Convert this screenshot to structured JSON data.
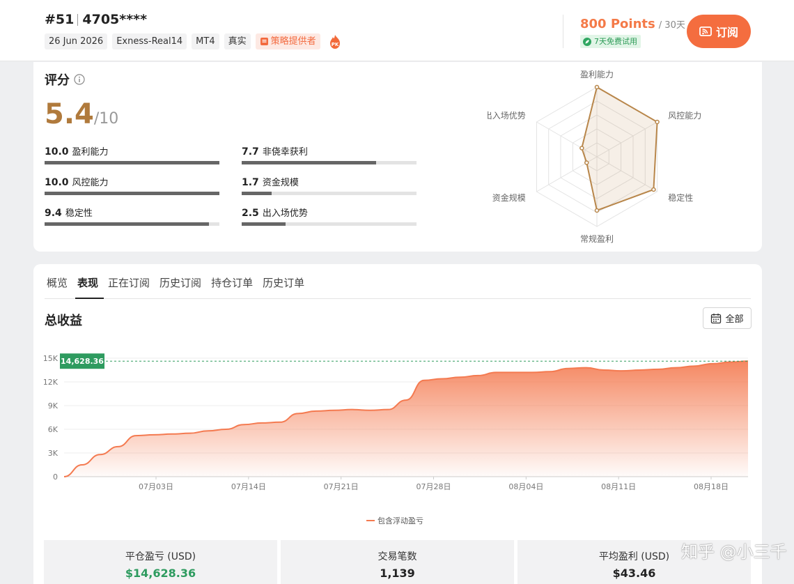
{
  "header": {
    "rank": "#51",
    "account_id": "4705****",
    "tags": [
      "26 Jun 2026",
      "Exness-Real14",
      "MT4",
      "真实"
    ],
    "provider_tag": "策略提供者",
    "points_value": "800 Points",
    "points_unit": "/ 30天",
    "trial": "7天免费试用",
    "subscribe_label": "订阅",
    "accent_color": "#f46d3f"
  },
  "score": {
    "title": "评分",
    "value": "5.4",
    "max": "/10",
    "metrics": [
      {
        "value": "10.0",
        "label": "盈利能力",
        "score": 10.0
      },
      {
        "value": "7.7",
        "label": "非侥幸获利",
        "score": 7.7
      },
      {
        "value": "10.0",
        "label": "风控能力",
        "score": 10.0
      },
      {
        "value": "1.7",
        "label": "资金规模",
        "score": 1.7
      },
      {
        "value": "9.4",
        "label": "稳定性",
        "score": 9.4
      },
      {
        "value": "2.5",
        "label": "出入场优势",
        "score": 2.5
      }
    ],
    "radar_axes": [
      {
        "label": "盈利能力",
        "score": 10.0
      },
      {
        "label": "风控能力",
        "score": 10.0
      },
      {
        "label": "稳定性",
        "score": 9.4
      },
      {
        "label": "常规盈利",
        "score": 7.7
      },
      {
        "label": "资金规模",
        "score": 1.7
      },
      {
        "label": "出入场优势",
        "score": 2.5
      }
    ]
  },
  "tabs": [
    "概览",
    "表现",
    "正在订阅",
    "历史订阅",
    "持仓订单",
    "历史订单"
  ],
  "active_tab": "表现",
  "section_title": "总收益",
  "range_label": "全部",
  "chart_data": {
    "type": "area",
    "x_tick_labels": [
      "07月03日",
      "07月14日",
      "07月21日",
      "07月28日",
      "08月04日",
      "08月11日",
      "08月18日"
    ],
    "y_tick_labels": [
      "0",
      "3K",
      "6K",
      "9K",
      "12K",
      "15K"
    ],
    "ylim": [
      0,
      15000
    ],
    "grid": true,
    "legend": "bottom-center",
    "current_value_label": "14,628.36",
    "series": [
      {
        "name": "包含浮动盈亏",
        "color": "#f47a50",
        "values": [
          0,
          1500,
          2800,
          3800,
          5200,
          5300,
          5400,
          5500,
          5800,
          6000,
          6600,
          6800,
          6900,
          8000,
          8300,
          8400,
          8500,
          8400,
          8500,
          9700,
          12200,
          12400,
          12600,
          12800,
          13200,
          13200,
          13200,
          13300,
          13700,
          13800,
          13500,
          13400,
          13500,
          13600,
          13800,
          14000,
          14300,
          14500,
          14628.36
        ]
      }
    ]
  },
  "stats": [
    {
      "label": "平仓盈亏 (USD)",
      "value": "$14,628.36"
    },
    {
      "label": "交易笔数",
      "value": "1,139"
    },
    {
      "label": "平均盈利 (USD)",
      "value": "$43.46"
    }
  ],
  "watermark": "知乎 @小三千"
}
